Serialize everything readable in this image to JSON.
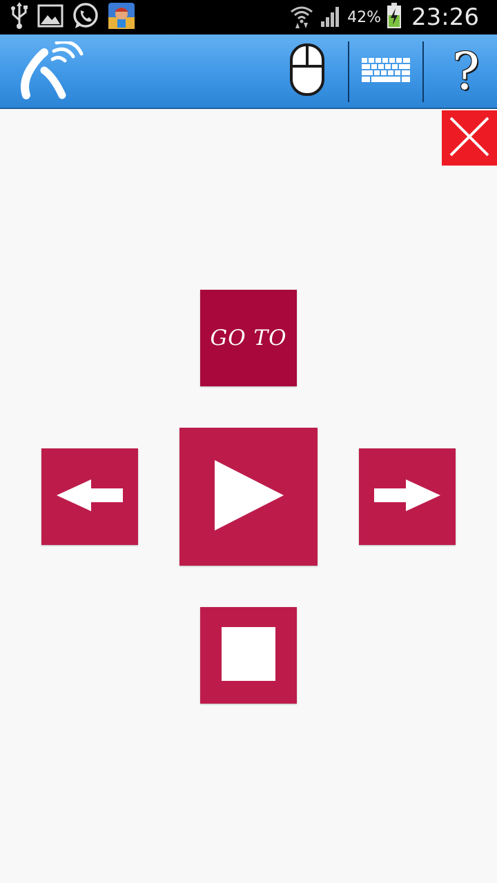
{
  "status_bar": {
    "icons": [
      "usb-icon",
      "image-icon",
      "whatsapp-icon",
      "game-app-icon"
    ],
    "battery_percent": "42%",
    "time": "23:26"
  },
  "app_bar": {
    "logo": "remote-signal-logo-icon",
    "actions": [
      {
        "name": "mouse-button",
        "icon": "mouse-icon"
      },
      {
        "name": "keyboard-button",
        "icon": "keyboard-icon"
      },
      {
        "name": "help-button",
        "icon": "help-icon",
        "label": "?"
      }
    ],
    "background_color": "#3f97e6"
  },
  "controls": {
    "goto_label": "GO TO",
    "play_icon": "play-icon",
    "previous_icon": "arrow-left-icon",
    "next_icon": "arrow-right-icon",
    "stop_icon": "stop-icon",
    "button_color": "#bd1c4b",
    "goto_color": "#a8083c",
    "close_color": "#ed1c24"
  }
}
